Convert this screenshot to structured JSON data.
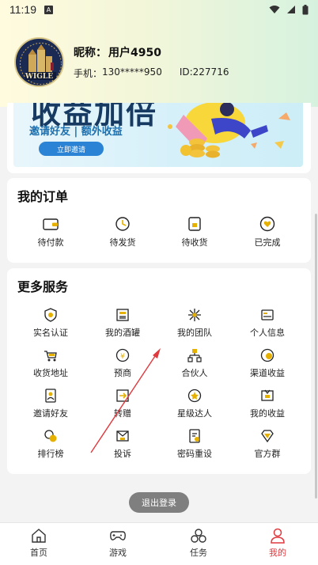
{
  "status_bar": {
    "time": "11:19",
    "notification_badge": "A"
  },
  "profile": {
    "avatar_text": "WIGLE",
    "nickname_label": "昵称：",
    "nickname_value": "用户4950",
    "phone_label": "手机：",
    "phone_value": "130*****950",
    "id_label": "ID:",
    "id_value": "227716"
  },
  "banner": {
    "headline": "收益加倍",
    "subtitle": "邀请好友 | 额外收益",
    "button_label": "立即邀请"
  },
  "orders": {
    "title": "我的订单",
    "items": [
      {
        "label": "待付款",
        "icon": "wallet-icon"
      },
      {
        "label": "待发货",
        "icon": "clock-icon"
      },
      {
        "label": "待收货",
        "icon": "receive-icon"
      },
      {
        "label": "已完成",
        "icon": "heart-icon"
      }
    ]
  },
  "services": {
    "title": "更多服务",
    "items": [
      {
        "label": "实名认证",
        "icon": "id-verify-icon"
      },
      {
        "label": "我的酒罐",
        "icon": "wine-jar-icon"
      },
      {
        "label": "我的团队",
        "icon": "team-icon"
      },
      {
        "label": "个人信息",
        "icon": "personal-info-icon"
      },
      {
        "label": "收货地址",
        "icon": "address-icon"
      },
      {
        "label": "预商",
        "icon": "pre-merchant-icon"
      },
      {
        "label": "合伙人",
        "icon": "partner-icon"
      },
      {
        "label": "渠道收益",
        "icon": "channel-income-icon"
      },
      {
        "label": "邀请好友",
        "icon": "invite-friend-icon"
      },
      {
        "label": "转赠",
        "icon": "transfer-gift-icon"
      },
      {
        "label": "星级达人",
        "icon": "star-expert-icon"
      },
      {
        "label": "我的收益",
        "icon": "my-income-icon"
      },
      {
        "label": "排行榜",
        "icon": "ranking-icon"
      },
      {
        "label": "投诉",
        "icon": "complaint-icon"
      },
      {
        "label": "密码重设",
        "icon": "password-reset-icon"
      },
      {
        "label": "官方群",
        "icon": "official-group-icon"
      }
    ]
  },
  "logout_label": "退出登录",
  "tabbar": {
    "items": [
      {
        "label": "首页",
        "icon": "home-icon"
      },
      {
        "label": "游戏",
        "icon": "gamepad-icon"
      },
      {
        "label": "任务",
        "icon": "task-icon"
      },
      {
        "label": "我的",
        "icon": "profile-icon"
      }
    ],
    "active_index": 3
  },
  "colors": {
    "accent_red": "#e0393e",
    "icon_gold": "#d9a400",
    "banner_blue": "#2a83d4",
    "logout_gray": "#7f7f7f"
  }
}
